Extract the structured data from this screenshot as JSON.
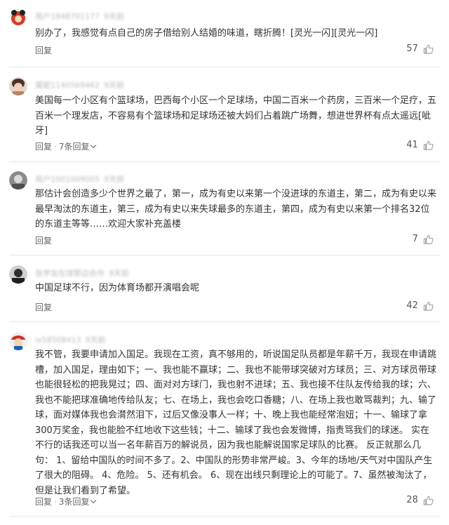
{
  "comments": [
    {
      "user": "用户1848701177",
      "time": "9天前",
      "text": "别办了，我感觉有点自己的房子借给别人结婚的味道，瞎折腾！[灵光一闪][灵光一闪]",
      "reply_label": "回复",
      "replies_label": "",
      "likes": "57",
      "avatar_color": "#d43c2c"
    },
    {
      "user": "莫妮1140569462",
      "time": "9天前",
      "text": "美国每一个小区有个篮球场，巴西每个小区一个足球场，中国二百米一个药房，三百米一个足疗，五百米一个理发店，不容易有个篮球场和足球场还被大妈们占着跳广场舞，想进世界杯有点太遥远[呲牙]",
      "reply_label": "回复",
      "replies_label": "7条回复",
      "likes": "41",
      "avatar_color": "#c69a82"
    },
    {
      "user": "用户1001009005",
      "time": "9天前",
      "text": "那估计会创造多少个世界之最了，第一，成为有史以来第一个没进球的东道主，第二，成为有史以来最早淘汰的东道主，第三，成为有史以来失球最多的东道主，第四，成为有史以来第一个排名32位的东道主等等……欢迎大家补充盖楼",
      "reply_label": "回复",
      "replies_label": "",
      "likes": "7",
      "avatar_color": "#6e6e6e"
    },
    {
      "user": "张学友在球那边合作",
      "time": "9天前",
      "text": "中国足球不行，因为体育场都开演唱会呢",
      "reply_label": "回复",
      "replies_label": "",
      "likes": "42",
      "avatar_color": "#3a3a3a"
    },
    {
      "user": "lx58508413",
      "time": "9天前",
      "text": "我不管，我要申请加入国足。我现在工资，真不够用的，听说国足队员都是年薪千万，我现在申请跳槽，加入国足，理由如下；一、我也能不赢球；二、我也不能带球突破对方球员；三、对方球员带球也能很轻松的把我晃过；四、面对对方球门，我也射不进球；五、我也接不住队友传给我的球；六、我也不能把球准确地传给队友；七、在场上，我也会吃口香糖；八、在场上我也敢骂裁判；九、输了球，面对媒体我也会潸然泪下，过后又像没事人一样；十、晚上我也能经常泡妞；十一、输球了拿300万奖金，我也能脸不红地收下这些钱；十二、输球了我也会发微博，指责骂我们的球迷。 实在不行的话我还可以当一名年薪百万的解说员，因为我也能解说国家足球队的比赛。 反正就那么几句： 1、留给中国队的时间不多了。2、中国队的形势非常严峻。3、今年的场地/天气对中国队产生了很大的阻碍。 4、危险。 5、还有机会。 6、现在出线只剩理论上的可能了。7、虽然被淘汰了，但是让我们看到了希望。",
      "reply_label": "回复",
      "replies_label": "3条回复",
      "likes": "28",
      "avatar_color": "#c9302c"
    }
  ],
  "colors": {
    "text": "#333333",
    "meta": "#b9b9b9",
    "action": "#666666",
    "divider": "#e6e6e6"
  },
  "icons": {
    "like": "thumbs-up-icon",
    "expand": "chevron-down-icon"
  }
}
